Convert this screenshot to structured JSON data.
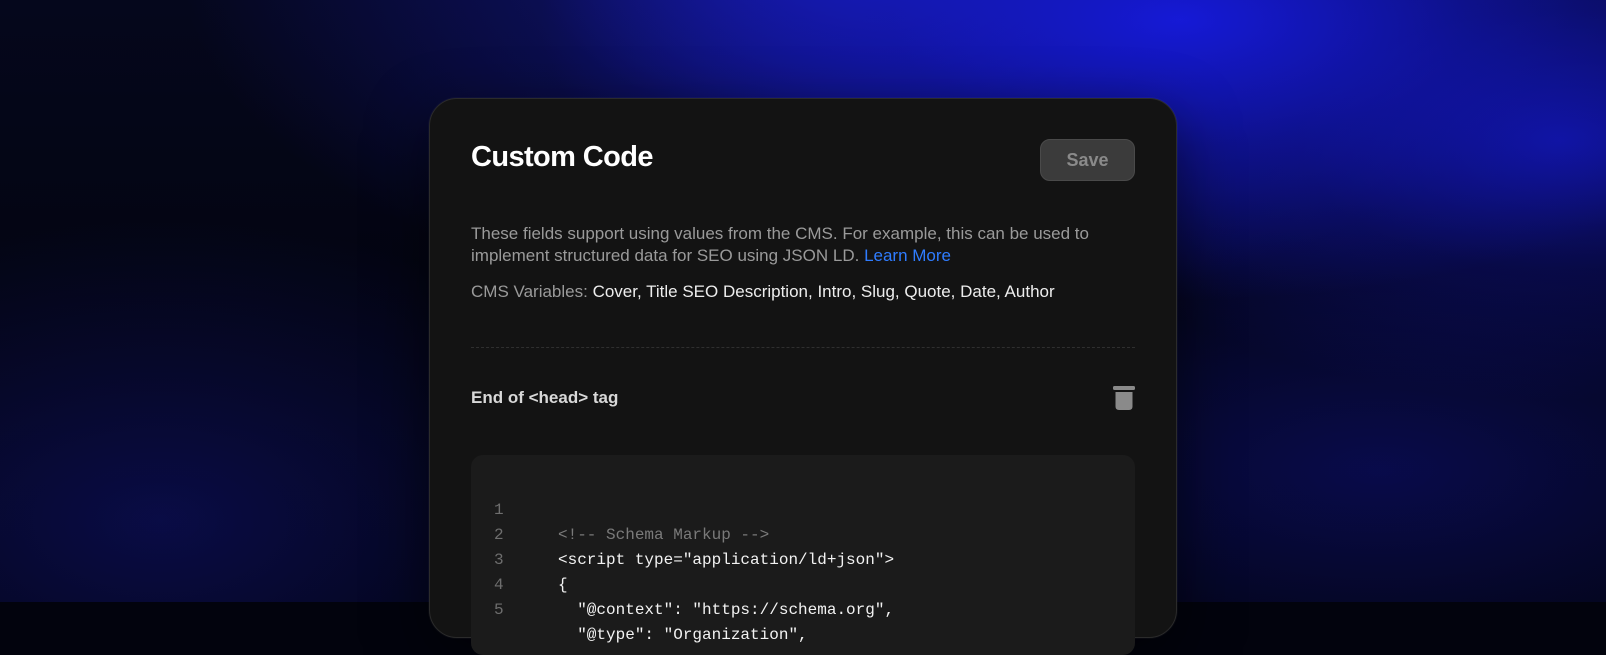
{
  "panel": {
    "title": "Custom Code",
    "save_label": "Save",
    "description": "These fields support using values from the CMS. For example, this can be used to implement structured data for SEO using JSON LD.",
    "learn_more_label": "Learn More",
    "cms_variables_label": "CMS Variables:",
    "cms_variables_values": "Cover, Title SEO Description, Intro, Slug, Quote, Date, Author"
  },
  "section": {
    "label": "End of <head> tag",
    "delete_icon": "trash-icon"
  },
  "code": {
    "lines": [
      {
        "num": "1",
        "text": "<!-- Schema Markup -->"
      },
      {
        "num": "2",
        "text": "<script type=\"application/ld+json\">"
      },
      {
        "num": "3",
        "text": "{"
      },
      {
        "num": "4",
        "text": "  \"@context\": \"https://schema.org\","
      },
      {
        "num": "5",
        "text": "  \"@type\": \"Organization\","
      }
    ]
  },
  "colors": {
    "accent_link": "#2f7cff",
    "card_background": "#131313",
    "code_background": "#1b1b1b",
    "background_glow": "#1a1fd6"
  }
}
